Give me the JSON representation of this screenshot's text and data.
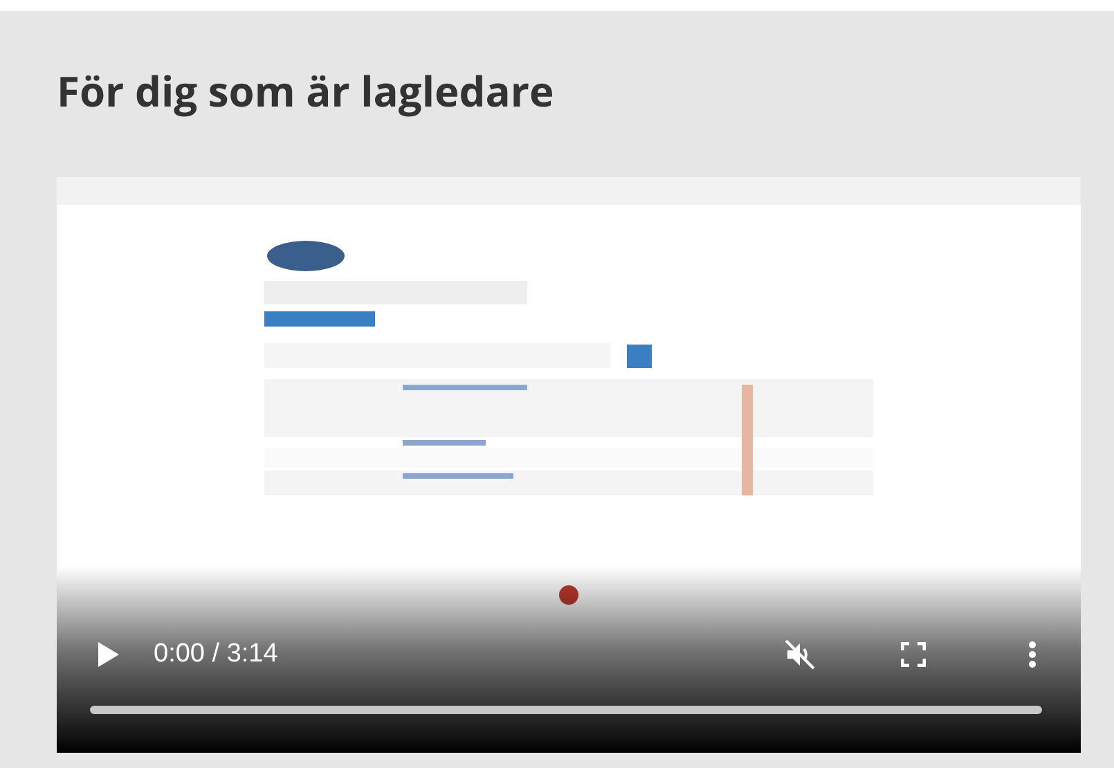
{
  "heading": "För dig som är lagledare",
  "video": {
    "kind": "picture",
    "time": "0:00 / 3:14",
    "playing": false,
    "muted": true,
    "progress": {
      "level": 0
    }
  }
}
